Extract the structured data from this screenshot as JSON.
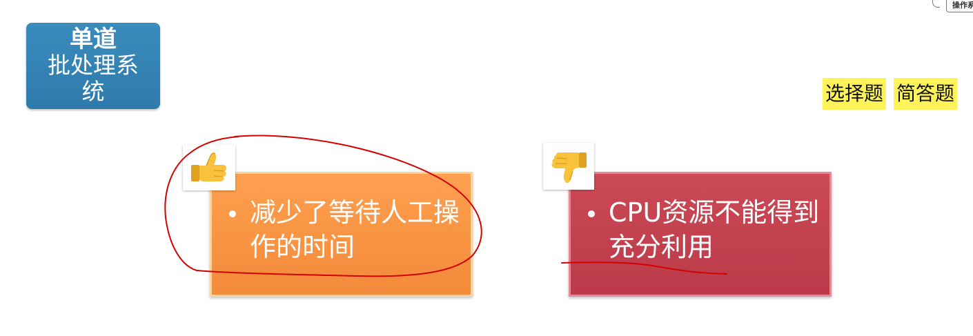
{
  "title_box": {
    "line1": "单道",
    "line2": "批处理系",
    "line3": "统"
  },
  "corner_tag": {
    "label": "操作系"
  },
  "tags": {
    "choice": "选择题",
    "answer": "简答题"
  },
  "pros": {
    "icon": "thumbs-up-icon",
    "text": "减少了等待人工操作的时间"
  },
  "cons": {
    "icon": "thumbs-down-icon",
    "text": "CPU资源不能得到充分利用"
  },
  "colors": {
    "title_bg": "#2e7aab",
    "pro_card": "#f28a3a",
    "con_card": "#bb3a49",
    "highlight": "#fff35a",
    "ink": "#d60000"
  }
}
